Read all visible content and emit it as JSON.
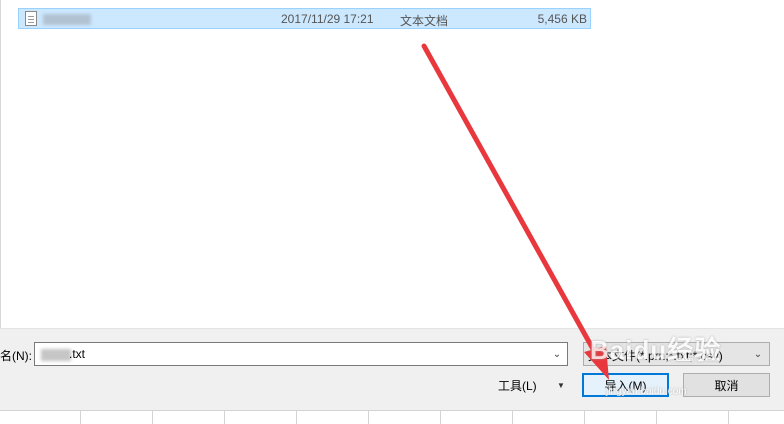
{
  "file_list": {
    "rows": [
      {
        "name": "",
        "date": "2017/11/29 17:21",
        "type": "文本文档",
        "size": "5,456 KB"
      }
    ]
  },
  "footer": {
    "filename_label": "名(N):",
    "filename_value": ".txt",
    "filetype_value": "文本文件(*.prn;*.txt;*.csv)",
    "tools_label": "工具(L)",
    "import_label": "导入(M)",
    "cancel_label": "取消"
  },
  "annotation": {
    "arrow_color": "#e8383d"
  },
  "watermark": {
    "text": "Baidu经验",
    "sub": "jingyan.baidu.com"
  }
}
